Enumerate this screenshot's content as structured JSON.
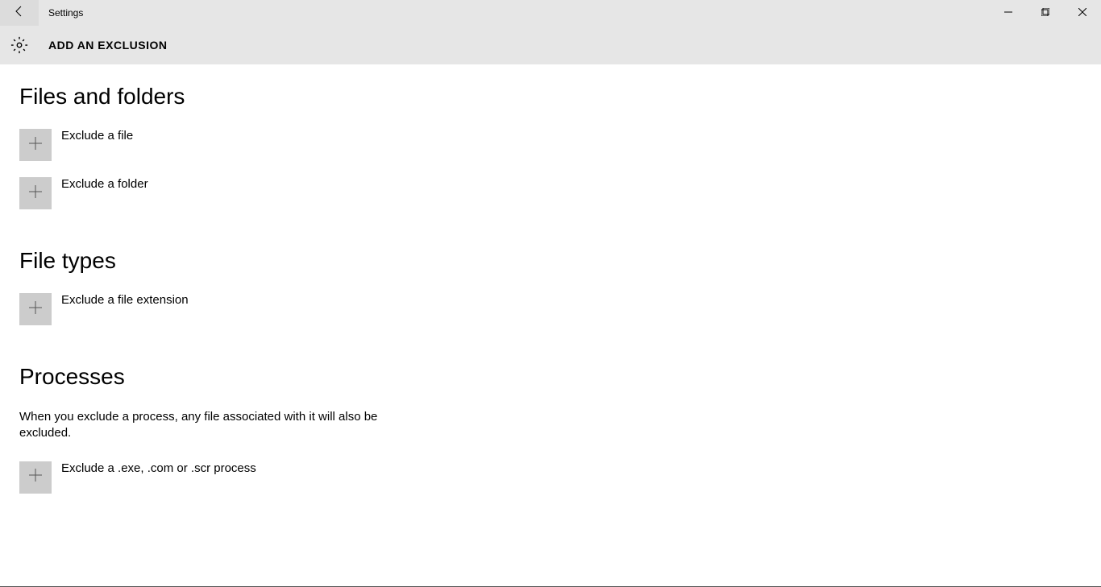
{
  "titlebar": {
    "app_title": "Settings"
  },
  "header": {
    "page_title": "ADD AN EXCLUSION"
  },
  "sections": {
    "files_folders": {
      "heading": "Files and folders",
      "exclude_file": "Exclude a file",
      "exclude_folder": "Exclude a folder"
    },
    "file_types": {
      "heading": "File types",
      "exclude_extension": "Exclude a file extension"
    },
    "processes": {
      "heading": "Processes",
      "description": "When you exclude a process, any file associated with it will also be excluded.",
      "exclude_process": "Exclude a .exe, .com or .scr process"
    }
  }
}
